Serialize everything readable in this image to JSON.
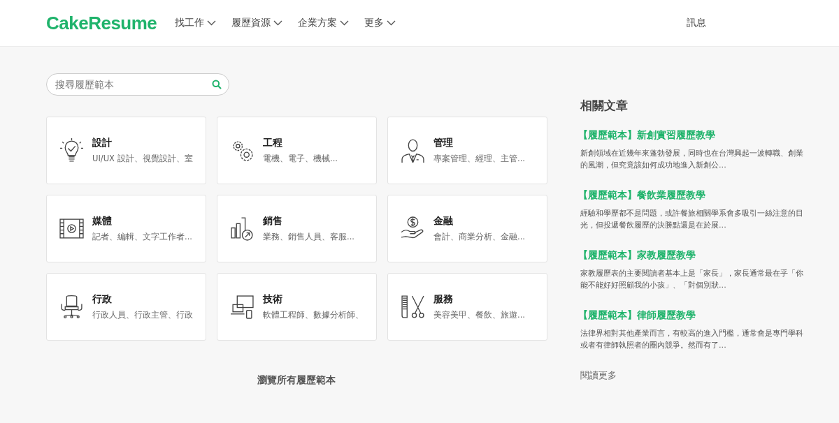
{
  "header": {
    "logo": "CakeResume",
    "nav": [
      {
        "label": "找工作"
      },
      {
        "label": "履歷資源"
      },
      {
        "label": "企業方案"
      },
      {
        "label": "更多"
      }
    ],
    "messages": "訊息"
  },
  "search": {
    "placeholder": "搜尋履歷範本"
  },
  "categories": [
    {
      "kind": "bulb",
      "title": "設計",
      "desc": "UI/UX 設計、視覺設計、室"
    },
    {
      "kind": "gears",
      "title": "工程",
      "desc": "電機、電子、機械..."
    },
    {
      "kind": "person",
      "title": "管理",
      "desc": "專案管理、經理、主管..."
    },
    {
      "kind": "film",
      "title": "媒體",
      "desc": "記者、編輯、文字工作者..."
    },
    {
      "kind": "chart",
      "title": "銷售",
      "desc": "業務、銷售人員、客服..."
    },
    {
      "kind": "money",
      "title": "金融",
      "desc": "會計、商業分析、金融..."
    },
    {
      "kind": "chair",
      "title": "行政",
      "desc": "行政人員、行政主管、行政"
    },
    {
      "kind": "devices",
      "title": "技術",
      "desc": "軟體工程師、數據分析師、"
    },
    {
      "kind": "scissors",
      "title": "服務",
      "desc": "美容美甲、餐飲、旅遊..."
    }
  ],
  "browse_all": "瀏覽所有履歷範本",
  "related": {
    "title": "相關文章",
    "articles": [
      {
        "title": "【履歷範本】新創實習履歷教學",
        "excerpt": "新創領域在近幾年來蓬勃發展，同時也在台灣興起一波轉職、創業的風潮，但究竟該如何成功地進入新創公..."
      },
      {
        "title": "【履歷範本】餐飲業履歷教學",
        "excerpt": "經驗和學歷都不是問題，或許餐旅相關學系會多吸引一絲注意的目光，但投遞餐飲履歷的決勝點還是在於展..."
      },
      {
        "title": "【履歷範本】家教履歷教學",
        "excerpt": "家教履歷表的主要閱讀者基本上是「家長」，家長通常最在乎「你能不能好好照顧我的小孩」、「對個別狀..."
      },
      {
        "title": "【履歷範本】律師履歷教學",
        "excerpt": "法律界相對其他產業而言，有較高的進入門檻，通常會是專門學科或者有律師執照者的圈內競爭。然而有了..."
      }
    ],
    "read_more": "閱讀更多"
  }
}
